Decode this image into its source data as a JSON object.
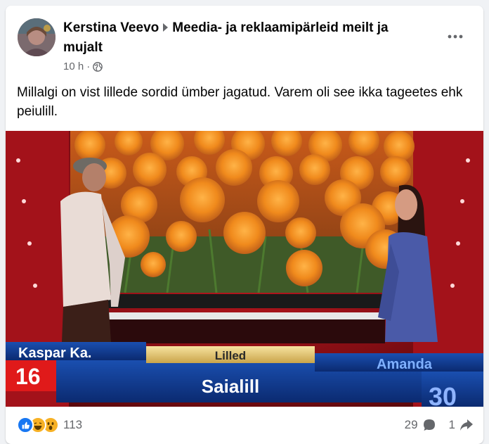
{
  "post": {
    "author": "Kerstina Veevo",
    "group": "Meedia- ja reklaamipärleid meilt ja mujalt",
    "time": "10 h",
    "separator": "·",
    "text": "Millalgi on vist lillede sordid ümber jagatud. Varem oli see ikka tageetes ehk peiulill."
  },
  "image": {
    "player_left_name": "Kaspar Ka.",
    "player_left_score": "16",
    "category": "Lilled",
    "answer": "Saialill",
    "player_right_name": "Amanda",
    "player_right_score": "30"
  },
  "footer": {
    "reaction_count": "113",
    "comment_count": "29",
    "share_count": "1",
    "reactions": [
      "like-icon",
      "haha-icon",
      "wow-icon"
    ]
  },
  "colors": {
    "like": "#1877f2",
    "emoji": "#f7b125",
    "muted": "#65676b"
  }
}
